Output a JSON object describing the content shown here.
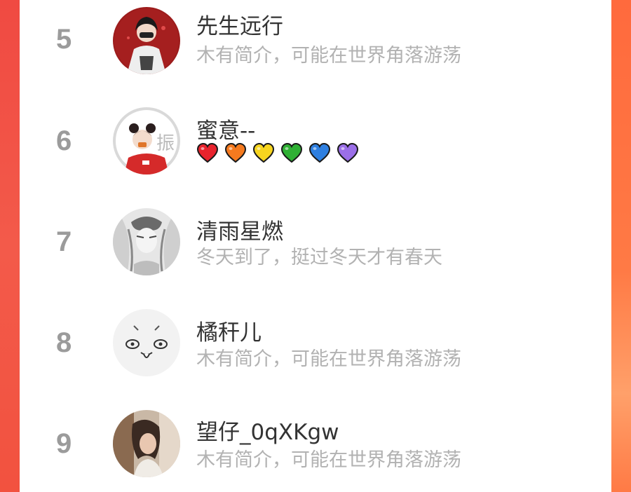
{
  "leaderboard": {
    "rows": [
      {
        "rank": "5",
        "name": "先生远行",
        "bio": "木有简介，可能在世界角落游荡"
      },
      {
        "rank": "6",
        "name": "蜜意--",
        "bio_hearts": [
          {
            "icon": "red-heart-icon",
            "color": "#e8232d"
          },
          {
            "icon": "orange-heart-icon",
            "color": "#f57a1f"
          },
          {
            "icon": "yellow-heart-icon",
            "color": "#f7d51f"
          },
          {
            "icon": "green-heart-icon",
            "color": "#2fb034"
          },
          {
            "icon": "blue-heart-icon",
            "color": "#2e7fe0"
          },
          {
            "icon": "purple-heart-icon",
            "color": "#9b6fe8"
          }
        ]
      },
      {
        "rank": "7",
        "name": "清雨星燃",
        "bio": "冬天到了，挺过冬天才有春天"
      },
      {
        "rank": "8",
        "name": "橘秆儿",
        "bio": "木有简介，可能在世界角落游荡"
      },
      {
        "rank": "9",
        "name": "望仔_0qXKgw",
        "bio": "木有简介，可能在世界角落游荡"
      }
    ]
  },
  "colors": {
    "rank": "#9b9b9b",
    "name": "#333333",
    "bio": "#b2b2b2",
    "left_border": "#f24a3e",
    "right_border": "#ff7a46"
  }
}
